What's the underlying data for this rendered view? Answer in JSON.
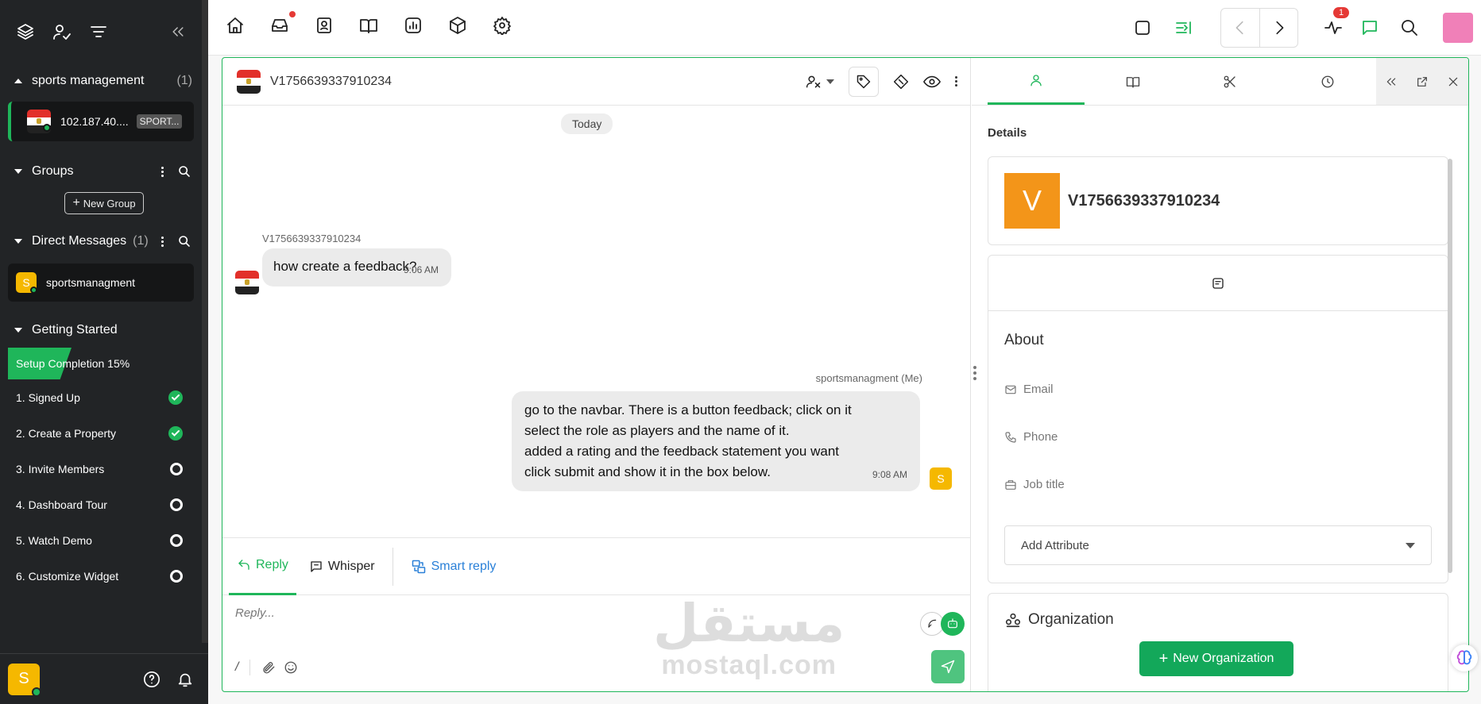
{
  "sidebar": {
    "inbox_section": {
      "title": "sports management",
      "count": "(1)"
    },
    "room": {
      "ip": "102.187.40....",
      "tag": "SPORT..."
    },
    "groups": {
      "title": "Groups",
      "new_group_label": "New Group"
    },
    "direct_messages": {
      "title": "Direct Messages",
      "count": "(1)",
      "item": {
        "avatar": "S",
        "name": "sportsmanagment"
      }
    },
    "getting_started": {
      "title": "Getting Started",
      "progress_label": "Setup Completion 15%",
      "progress_value": 0.15,
      "steps": [
        {
          "label": "1. Signed Up",
          "done": true
        },
        {
          "label": "2. Create a Property",
          "done": true
        },
        {
          "label": "3. Invite Members",
          "done": false
        },
        {
          "label": "4. Dashboard Tour",
          "done": false
        },
        {
          "label": "5. Watch Demo",
          "done": false
        },
        {
          "label": "6. Customize Widget",
          "done": false
        }
      ]
    },
    "user_avatar": "S"
  },
  "topnav": {
    "icons_left": [
      "home-icon",
      "inbox-icon",
      "contacts-icon",
      "knowledge-book-icon",
      "reports-icon",
      "package-icon",
      "settings-icon"
    ],
    "activity_badge": "1"
  },
  "chat": {
    "title": "V1756639337910234",
    "date_divider": "Today",
    "messages": [
      {
        "sender": "V1756639337910234",
        "text": "how create a feedback?",
        "time": "9:06 AM"
      },
      {
        "sender": "sportsmanagment (Me)",
        "lines": [
          "go to the navbar. There is a button feedback; click on it",
          "select the role as players and the name of it.",
          "added a rating and the feedback statement you want",
          "click submit and show it in the box below."
        ],
        "time": "9:08 AM",
        "avatar": "S"
      }
    ],
    "reply_tabs": {
      "reply": "Reply",
      "whisper": "Whisper",
      "smart_reply": "Smart reply"
    },
    "reply_placeholder": "Reply...",
    "slash": "/",
    "watermark": {
      "arabic": "مستقل",
      "latin": "mostaql.com"
    }
  },
  "details": {
    "section_label": "Details",
    "contact": {
      "avatar_letter": "V",
      "name": "V1756639337910234",
      "avatar_color": "#f39519"
    },
    "about": {
      "title": "About",
      "email": "Email",
      "phone": "Phone",
      "job_title": "Job title",
      "add_attribute": "Add Attribute"
    },
    "organization": {
      "title": "Organization",
      "new_button": "New Organization"
    }
  },
  "colors": {
    "accent": "#1fb65a",
    "sidebar_bg": "#222426",
    "badge_red": "#e53935"
  }
}
